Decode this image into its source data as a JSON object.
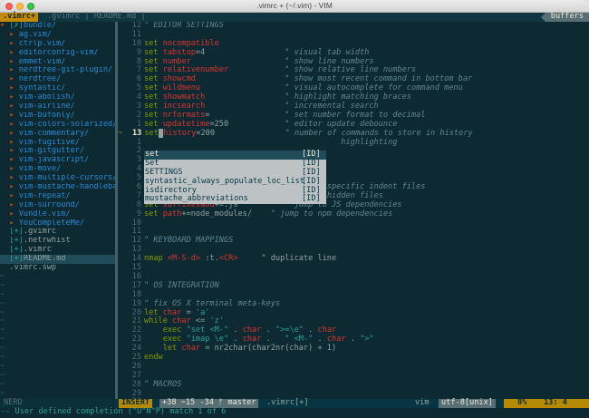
{
  "window": {
    "title": ".vimrc + (~/.vim) - VIM"
  },
  "tabline": {
    "active_tab": ".vimrc+",
    "inactive_tabs": ".gvimrc | README.md |",
    "buffers_label": "buffers"
  },
  "tree": [
    {
      "prefix": "▾ ",
      "mark": "[✗]",
      "name": "bundle/",
      "kind": "dir"
    },
    {
      "prefix": "  ▸ ",
      "mark": "",
      "name": "ag.vim/",
      "kind": "dir"
    },
    {
      "prefix": "  ▸ ",
      "mark": "",
      "name": "ctrlp.vim/",
      "kind": "dir"
    },
    {
      "prefix": "  ▸ ",
      "mark": "",
      "name": "editorconfig-vim/",
      "kind": "dir"
    },
    {
      "prefix": "  ▸ ",
      "mark": "",
      "name": "emmet-vim/",
      "kind": "dir"
    },
    {
      "prefix": "  ▸ ",
      "mark": "",
      "name": "nerdtree-git-plugin/",
      "kind": "dir"
    },
    {
      "prefix": "  ▸ ",
      "mark": "",
      "name": "nerdtree/",
      "kind": "dir"
    },
    {
      "prefix": "  ▸ ",
      "mark": "",
      "name": "syntastic/",
      "kind": "dir"
    },
    {
      "prefix": "  ▸ ",
      "mark": "",
      "name": "vim-abolish/",
      "kind": "dir"
    },
    {
      "prefix": "  ▸ ",
      "mark": "",
      "name": "vim-airline/",
      "kind": "dir"
    },
    {
      "prefix": "  ▸ ",
      "mark": "",
      "name": "vim-bufonly/",
      "kind": "dir"
    },
    {
      "prefix": "  ▸ ",
      "mark": "",
      "name": "vim-colors-solarized/",
      "kind": "dir"
    },
    {
      "prefix": "  ▸ ",
      "mark": "",
      "name": "vim-commentary/",
      "kind": "dir"
    },
    {
      "prefix": "  ▸ ",
      "mark": "",
      "name": "vim-fugitive/",
      "kind": "dir"
    },
    {
      "prefix": "  ▸ ",
      "mark": "",
      "name": "vim-gitgutter/",
      "kind": "dir"
    },
    {
      "prefix": "  ▸ ",
      "mark": "",
      "name": "vim-javascript/",
      "kind": "dir"
    },
    {
      "prefix": "  ▸ ",
      "mark": "",
      "name": "vim-move/",
      "kind": "dir"
    },
    {
      "prefix": "  ▸ ",
      "mark": "",
      "name": "vim-multiple-cursors/",
      "kind": "dir"
    },
    {
      "prefix": "  ▸ ",
      "mark": "",
      "name": "vim-mustache-handlebars/",
      "kind": "dir"
    },
    {
      "prefix": "  ▸ ",
      "mark": "",
      "name": "vim-repeat/",
      "kind": "dir"
    },
    {
      "prefix": "  ▸ ",
      "mark": "",
      "name": "vim-surround/",
      "kind": "dir"
    },
    {
      "prefix": "  ▸ ",
      "mark": "",
      "name": "Vundle.vim/",
      "kind": "dir"
    },
    {
      "prefix": "  ▸ ",
      "mark": "",
      "name": "YouCompleteMe/",
      "kind": "dir"
    },
    {
      "prefix": "  ",
      "mark": "[+]",
      "name": ".gvimrc",
      "kind": "file"
    },
    {
      "prefix": "  ",
      "mark": "[+]",
      "name": ".netrwhist",
      "kind": "file"
    },
    {
      "prefix": "  ",
      "mark": "[+]",
      "name": ".vimrc",
      "kind": "file"
    },
    {
      "prefix": "  ",
      "mark": "[+]",
      "name": "README.md",
      "kind": "file",
      "selected": true
    },
    {
      "prefix": "  ",
      "mark": "",
      "name": ".vimrc.swp",
      "kind": "file"
    }
  ],
  "tilde": "~",
  "editor": {
    "current_line_sign": "13",
    "lines": [
      {
        "n": "12",
        "parts": [
          [
            "cm",
            "\" EDITOR SETTINGS"
          ]
        ]
      },
      {
        "n": "",
        "parts": []
      },
      {
        "n": "",
        "parts": [
          [
            "kw",
            "set "
          ],
          [
            "opt",
            "nocompatible"
          ]
        ]
      },
      {
        "n": "",
        "parts": [
          [
            "kw",
            "set "
          ],
          [
            "opt",
            "tabstop"
          ],
          [
            "val",
            "=4                 "
          ],
          [
            "cm",
            "\" visual tab width"
          ]
        ]
      },
      {
        "n": "",
        "parts": [
          [
            "kw",
            "set "
          ],
          [
            "opt",
            "number"
          ],
          [
            "val",
            "                    "
          ],
          [
            "cm",
            "\" show line numbers"
          ]
        ]
      },
      {
        "n": "",
        "parts": [
          [
            "kw",
            "set "
          ],
          [
            "opt",
            "relativenumber"
          ],
          [
            "val",
            "            "
          ],
          [
            "cm",
            "\" show relative line numbers"
          ]
        ]
      },
      {
        "n": "",
        "parts": [
          [
            "kw",
            "set "
          ],
          [
            "opt",
            "showcmd"
          ],
          [
            "val",
            "                   "
          ],
          [
            "cm",
            "\" show most recent command in bottom bar"
          ]
        ]
      },
      {
        "n": "",
        "parts": [
          [
            "kw",
            "set "
          ],
          [
            "opt",
            "wildmenu"
          ],
          [
            "val",
            "                  "
          ],
          [
            "cm",
            "\" visual autocomplete for command menu"
          ]
        ]
      },
      {
        "n": "",
        "parts": [
          [
            "kw",
            "set "
          ],
          [
            "opt",
            "showmatch"
          ],
          [
            "val",
            "                 "
          ],
          [
            "cm",
            "\" highlight matching braces"
          ]
        ]
      },
      {
        "n": "",
        "parts": [
          [
            "kw",
            "set "
          ],
          [
            "opt",
            "incsearch"
          ],
          [
            "val",
            "                 "
          ],
          [
            "cm",
            "\" incremental search"
          ]
        ]
      },
      {
        "n": "",
        "parts": [
          [
            "kw",
            "set "
          ],
          [
            "opt",
            "nrformats"
          ],
          [
            "val",
            "=                "
          ],
          [
            "cm",
            "\" set number format to decimal"
          ]
        ]
      },
      {
        "n": "",
        "parts": [
          [
            "kw",
            "set "
          ],
          [
            "opt",
            "updatetime"
          ],
          [
            "val",
            "=250            "
          ],
          [
            "cm",
            "\" editor update debounce"
          ]
        ]
      },
      {
        "n": "",
        "current": true,
        "parts": [
          [
            "kw",
            "set"
          ],
          [
            "cursor",
            " "
          ],
          [
            "opt",
            "history"
          ],
          [
            "val",
            "=200               "
          ],
          [
            "cm",
            "\" number of commands to store in history"
          ]
        ]
      },
      {
        "n": "",
        "parts": [
          [
            "cm",
            "                                          highlighting"
          ]
        ]
      },
      {
        "n": "",
        "parts": []
      },
      {
        "n": "",
        "parts": []
      },
      {
        "n": "",
        "parts": []
      },
      {
        "n": "",
        "parts": []
      },
      {
        "n": "",
        "parts": [
          [
            "cm",
            "                                       specific indent files"
          ]
        ]
      },
      {
        "n": "",
        "parts": [
          [
            "kw",
            "set "
          ],
          [
            "opt",
            "wildignore"
          ],
          [
            "val",
            "+=*.swp         "
          ],
          [
            "cm",
            "\" ignore hidden files"
          ]
        ]
      },
      {
        "n": "",
        "parts": [
          [
            "kw",
            "set "
          ],
          [
            "opt",
            "suffixesadd"
          ],
          [
            "val",
            "+=.js          "
          ],
          [
            "cm",
            "\" jump to JS dependencies"
          ]
        ]
      },
      {
        "n": "",
        "parts": [
          [
            "kw",
            "set "
          ],
          [
            "opt",
            "path"
          ],
          [
            "val",
            "+=node_modules/    "
          ],
          [
            "cm",
            "\" jump to npm dependencies"
          ]
        ]
      },
      {
        "n": "",
        "parts": []
      },
      {
        "n": "",
        "parts": []
      },
      {
        "n": "",
        "parts": [
          [
            "cm",
            "\" KEYBOARD MAPPINGS"
          ]
        ]
      },
      {
        "n": "",
        "parts": []
      },
      {
        "n": "",
        "parts": [
          [
            "kw",
            "nmap "
          ],
          [
            "key",
            "<M-S-d>"
          ],
          [
            "val",
            " :t."
          ],
          [
            "key",
            "<CR>"
          ],
          [
            "val",
            "     \" duplicate line"
          ]
        ]
      },
      {
        "n": "",
        "parts": []
      },
      {
        "n": "",
        "parts": []
      },
      {
        "n": "",
        "parts": [
          [
            "cm",
            "\" OS INTEGRATION"
          ]
        ]
      },
      {
        "n": "",
        "parts": []
      },
      {
        "n": "",
        "parts": [
          [
            "cm",
            "\" fix OS X terminal meta-keys"
          ]
        ]
      },
      {
        "n": "",
        "parts": [
          [
            "kw",
            "let "
          ],
          [
            "opt",
            "char"
          ],
          [
            "val",
            " = "
          ],
          [
            "str",
            "'a'"
          ]
        ]
      },
      {
        "n": "",
        "parts": [
          [
            "kw",
            "while "
          ],
          [
            "opt",
            "char"
          ],
          [
            "val",
            " <= "
          ],
          [
            "str",
            "'z'"
          ]
        ]
      },
      {
        "n": "",
        "parts": [
          [
            "val",
            "    "
          ],
          [
            "kw",
            "exec "
          ],
          [
            "str",
            "\"set <M-\""
          ],
          [
            "val",
            " . "
          ],
          [
            "opt",
            "char"
          ],
          [
            "val",
            " . "
          ],
          [
            "str",
            "\">=\\e\""
          ],
          [
            "val",
            " . "
          ],
          [
            "opt",
            "char"
          ]
        ]
      },
      {
        "n": "",
        "parts": [
          [
            "val",
            "    "
          ],
          [
            "kw",
            "exec "
          ],
          [
            "str",
            "\"imap \\e\""
          ],
          [
            "val",
            " . "
          ],
          [
            "opt",
            "char"
          ],
          [
            "val",
            " .   "
          ],
          [
            "str",
            "\" <M-\""
          ],
          [
            "val",
            " . "
          ],
          [
            "opt",
            "char"
          ],
          [
            "val",
            " . "
          ],
          [
            "str",
            "\">\""
          ]
        ]
      },
      {
        "n": "",
        "parts": [
          [
            "val",
            "    "
          ],
          [
            "kw",
            "let "
          ],
          [
            "opt",
            "char"
          ],
          [
            "val",
            " = nr2char(char2nr(char) + 1)"
          ]
        ]
      },
      {
        "n": "",
        "parts": [
          [
            "kw",
            "endw"
          ]
        ]
      },
      {
        "n": "",
        "parts": []
      },
      {
        "n": "",
        "parts": []
      },
      {
        "n": "",
        "parts": [
          [
            "cm",
            "\" MACROS"
          ]
        ]
      },
      {
        "n": "",
        "parts": []
      },
      {
        "n": "",
        "parts": []
      }
    ]
  },
  "line_numbers": [
    "12",
    "11",
    "10",
    "9",
    "8",
    "7",
    "6",
    "5",
    "4",
    "3",
    "2",
    "1",
    "13",
    "1",
    "2",
    "3",
    "4",
    "5",
    "6",
    "7",
    "8",
    "9",
    "10",
    "11",
    "12",
    "13",
    "14",
    "15",
    "16",
    "17",
    "18",
    "19",
    "20",
    "21",
    "22",
    "23",
    "24",
    "25",
    "26",
    "27",
    "28",
    "29",
    "30"
  ],
  "completion_popup": [
    {
      "word": "set",
      "kind": "[ID]",
      "selected": true
    },
    {
      "word": "Set",
      "kind": "[ID]"
    },
    {
      "word": "SETTINGS",
      "kind": "[ID]"
    },
    {
      "word": "syntastic_always_populate_loc_list",
      "kind": "[ID]"
    },
    {
      "word": "isdirectory",
      "kind": "[ID]"
    },
    {
      "word": "mustache_abbreviations",
      "kind": "[ID]"
    }
  ],
  "statusline": {
    "nerd_label": "NERD",
    "mode": "INSERT",
    "git": "+38 ~15 -34 ᚠ master",
    "file": ".vimrc[+]",
    "filetype": "vim",
    "encoding": "utf-8[unix]",
    "percent": "8%",
    "position": "13:  4"
  },
  "cmdline": "-- User defined completion (^U^N^P) match 1 of 6"
}
